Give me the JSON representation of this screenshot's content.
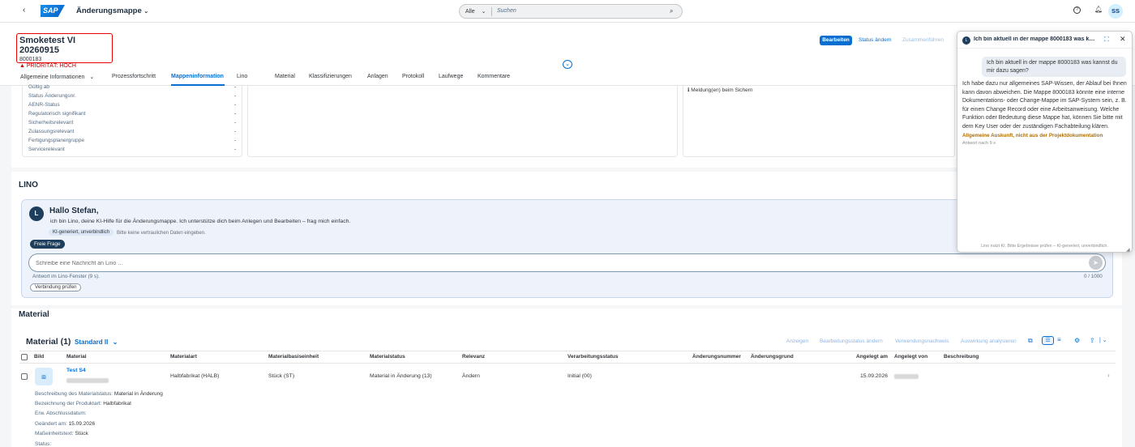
{
  "shell": {
    "logo": "SAP",
    "app_name": "Änderungsmappe",
    "search_scope": "Alle",
    "search_placeholder": "Suchen",
    "avatar": "SS"
  },
  "header": {
    "title": "Smoketest VI 20260915",
    "id": "8000183",
    "priority": "PRIORITÄT: HOCH",
    "actions": {
      "edit": "Bearbeiten",
      "change_status": "Status ändern",
      "merge": "Zusammenführen"
    }
  },
  "tabs": [
    "Allgemeine Informationen",
    "Prozessfortschritt",
    "Mappeninformation",
    "Lino",
    "Material",
    "Klassifizierungen",
    "Anlagen",
    "Protokoll",
    "Laufwege",
    "Kommentare"
  ],
  "info": {
    "rows": [
      {
        "label": "Gültig ab",
        "value": "-"
      },
      {
        "label": "Status Änderungsnr.",
        "value": "-"
      },
      {
        "label": "AENR-Status",
        "value": "-"
      },
      {
        "label": "Regulatorisch signifikant",
        "value": "-"
      },
      {
        "label": "Sicherheitsrelevant",
        "value": "-"
      },
      {
        "label": "Zulassungsrelevant",
        "value": "-"
      },
      {
        "label": "Fertigungsplanergruppe",
        "value": "-"
      },
      {
        "label": "Servicerelevant",
        "value": "-"
      }
    ],
    "message": "Meldung(en) beim Sichern"
  },
  "lino": {
    "section_title": "LINO",
    "hello": "Hallo Stefan,",
    "intro": "ich bin Lino, deine KI-Hilfe für die Änderungsmappe. Ich unterstütze dich beim Anlegen und Bearbeiten – frag mich einfach.",
    "badge": "KI-generiert, unverbindlich",
    "note": "Bitte keine vertraulichen Daten eingeben.",
    "chip": "Freie Frage",
    "input_placeholder": "Schreibe eine Nachricht an Lino …",
    "answer_note": "Antwort im Lino-Fenster (9 s).",
    "counter": "0 / 1000",
    "check_button": "Verbindung prüfen"
  },
  "material": {
    "section_title": "Material",
    "table_title": "Material (1)",
    "variant": "Standard II",
    "actions": [
      "Anzeigen",
      "Bearbeitungsstatus ändern",
      "Verwendungsnachweis",
      "Auswirkung analysieren"
    ],
    "columns": [
      "Bild",
      "Material",
      "Materialart",
      "Materialbasiseinheit",
      "Materialstatus",
      "Relevanz",
      "Verarbeitungsstatus",
      "Änderungsnummer",
      "Änderungsgrund",
      "Angelegt am",
      "Angelegt von",
      "Beschreibung"
    ],
    "row": {
      "material": "Test S4",
      "materialart": "Halbfabrikat (HALB)",
      "basiseinheit": "Stück (ST)",
      "status": "Material in Änderung (13)",
      "relevanz": "Ändern",
      "verarbeitung": "Initial (00)",
      "angelegt_am": "15.09.2026"
    },
    "details": [
      {
        "label": "Beschreibung des Materialstatus:",
        "value": "Material in Änderung"
      },
      {
        "label": "Bezeichnung der Produktart:",
        "value": "Halbfabrikat"
      },
      {
        "label": "Erw. Abschlussdatum:",
        "value": ""
      },
      {
        "label": "Geändert am:",
        "value": "15.09.2026"
      },
      {
        "label": "Maßeinheitstext:",
        "value": "Stück"
      },
      {
        "label": "Status:",
        "value": ""
      }
    ]
  },
  "chat": {
    "title": "Ich bin aktuell in der mappe 8000183 was ka...",
    "user_message": "Ich bin aktuell in der mappe 8000183 was kannst du mir dazu sagen?",
    "bot_message": "Ich habe dazu nur allgemeines SAP-Wissen, der Ablauf bei Ihnen kann davon abweichen. Die Mappe 8000183 könnte eine interne Dokumentations- oder Change-Mappe im SAP-System sein, z. B. für einen Change Record oder eine Arbeitsanweisung. Welche Funktion oder Bedeutung diese Mappe hat, können Sie bitte mit dem Key User oder der zuständigen Fachabteilung klären.",
    "bot_warning": "Allgemeine Auskunft, nicht aus der Projektdokumentation",
    "bot_time": "Antwort nach 9 s",
    "footer": "Lino nutzt KI. Bitte Ergebnisse prüfen – KI-generiert, unverbindlich."
  }
}
